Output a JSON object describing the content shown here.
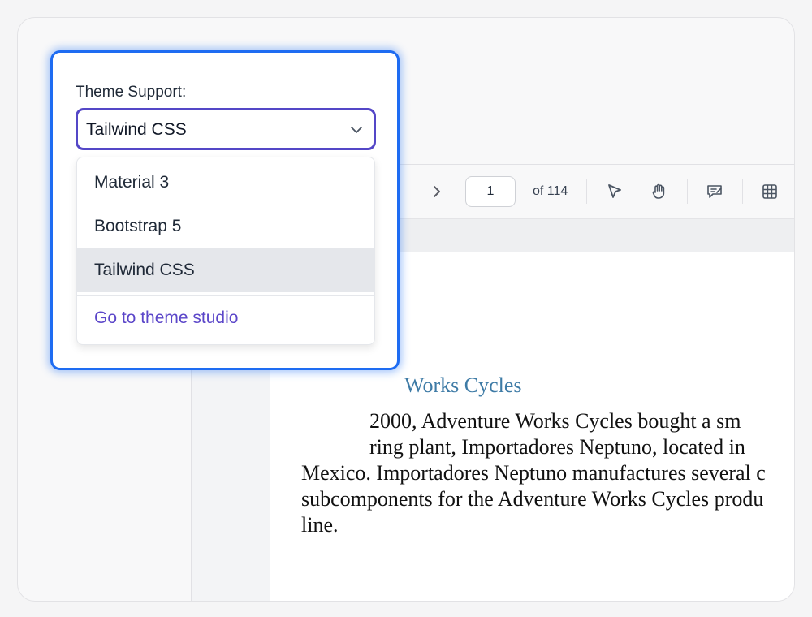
{
  "theme_popup": {
    "label": "Theme Support:",
    "selected_value": "Tailwind CSS",
    "options": [
      {
        "label": "Material 3"
      },
      {
        "label": "Bootstrap 5"
      },
      {
        "label": "Tailwind CSS"
      }
    ],
    "studio_link": "Go to theme studio",
    "colors": {
      "focus_border": "#1e6cf2",
      "select_border": "#5447c7",
      "link": "#5b46c9",
      "selected_option_bg": "#e5e7eb"
    }
  },
  "pdf_viewer": {
    "toolbar": {
      "current_page": "1",
      "page_total": "of 114",
      "icons": [
        "chevron-right-icon",
        "pointer-select-icon",
        "hand-pan-icon",
        "annotate-icon",
        "grid-icon"
      ]
    },
    "document": {
      "heading": "Works Cycles",
      "lines": [
        "2000, Adventure Works Cycles bought a sm",
        "ring plant, Importadores Neptuno, located in",
        "Mexico. Importadores Neptuno manufactures several c",
        "subcomponents for the Adventure Works Cycles produ",
        "line."
      ],
      "heading_color": "#3e7ba6"
    }
  }
}
